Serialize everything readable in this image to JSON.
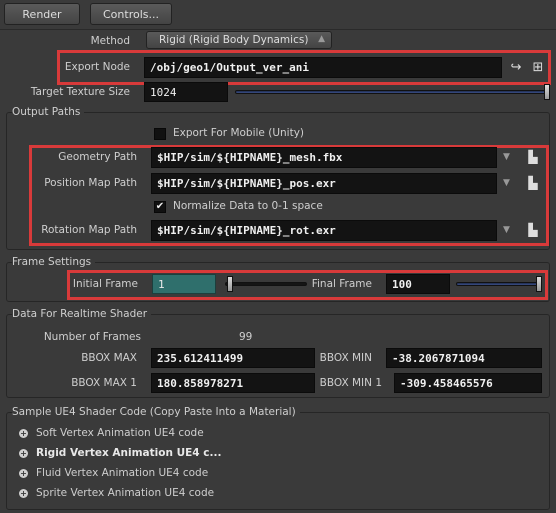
{
  "toolbar": {
    "render_label": "Render",
    "controls_label": "Controls..."
  },
  "method": {
    "label": "Method",
    "value": "Rigid (Rigid Body Dynamics)"
  },
  "export_node": {
    "label": "Export Node",
    "value": "/obj/geo1/Output_ver_ani"
  },
  "target_texture": {
    "label": "Target Texture Size",
    "value": "1024"
  },
  "output_paths": {
    "title": "Output Paths",
    "export_mobile_label": "Export For Mobile (Unity)",
    "geometry_label": "Geometry Path",
    "geometry_value": "$HIP/sim/${HIPNAME}_mesh.fbx",
    "position_label": "Position Map Path",
    "position_value": "$HIP/sim/${HIPNAME}_pos.exr",
    "normalize_label": "Normalize Data to 0-1 space",
    "rotation_label": "Rotation Map Path",
    "rotation_value": "$HIP/sim/${HIPNAME}_rot.exr"
  },
  "frame_settings": {
    "title": "Frame Settings",
    "initial_label": "Initial Frame",
    "initial_value": "1",
    "final_label": "Final Frame",
    "final_value": "100"
  },
  "realtime": {
    "title": "Data For Realtime Shader",
    "num_frames_label": "Number of Frames",
    "num_frames_value": "99",
    "bbox_max_label": "BBOX MAX",
    "bbox_max_value": "235.612411499",
    "bbox_min_label": "BBOX MIN",
    "bbox_min_value": "-38.2067871094",
    "bbox_max1_label": "BBOX MAX 1",
    "bbox_max1_value": "180.858978271",
    "bbox_min1_label": "BBOX MIN 1",
    "bbox_min1_value": "-309.458465576"
  },
  "shader_code": {
    "title": "Sample UE4 Shader Code (Copy Paste Into a Material)",
    "items": [
      "Soft Vertex Animation UE4 code",
      "Rigid Vertex Animation UE4 c...",
      "Fluid Vertex Animation UE4 code",
      "Sprite Vertex Animation UE4 code"
    ]
  },
  "colors": {
    "highlight_red": "#d83a3a",
    "slider_blue": "#3b4f87",
    "selected_field": "#2f6f6c"
  }
}
